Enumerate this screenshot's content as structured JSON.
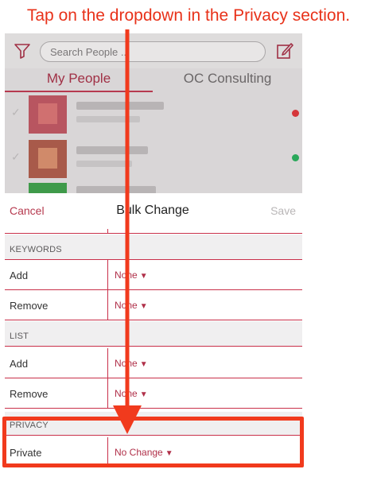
{
  "instruction": "Tap on the dropdown in the Privacy section.",
  "app": {
    "search_placeholder": "Search People ...",
    "tabs": [
      {
        "label": "My People"
      },
      {
        "label": "OC Consulting"
      }
    ],
    "contacts": [
      {
        "status_color": "#d5363a"
      },
      {
        "status_color": "#2aa85a"
      }
    ]
  },
  "bulk_change": {
    "cancel_label": "Cancel",
    "title": "Bulk Change",
    "save_label": "Save",
    "sections": [
      {
        "header": "KEYWORDS",
        "rows": [
          {
            "label": "Add",
            "value": "None"
          },
          {
            "label": "Remove",
            "value": "None"
          }
        ]
      },
      {
        "header": "LIST",
        "rows": [
          {
            "label": "Add",
            "value": "None"
          },
          {
            "label": "Remove",
            "value": "None"
          }
        ]
      },
      {
        "header": "PRIVACY",
        "rows": [
          {
            "label": "Private",
            "value": "No Change"
          }
        ]
      }
    ]
  },
  "colors": {
    "accent": "#b63a4f",
    "annotation": "#f13a1d"
  },
  "icons": [
    "filter-icon",
    "compose-icon",
    "dropdown-caret-icon",
    "checkmark-icon"
  ]
}
